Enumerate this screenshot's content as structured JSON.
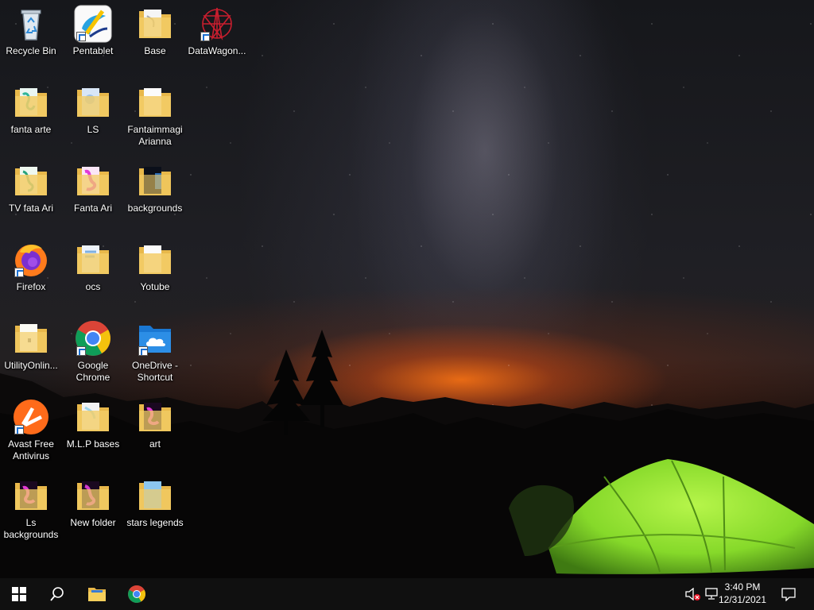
{
  "desktop": {
    "icons": [
      {
        "label": "Recycle Bin",
        "type": "recycle-bin",
        "shortcut": false
      },
      {
        "label": "Pentablet",
        "type": "pentablet-app",
        "shortcut": true
      },
      {
        "label": "Base",
        "type": "folder",
        "shortcut": false
      },
      {
        "label": "DataWagon...",
        "type": "datawagon-app",
        "shortcut": true
      },
      {
        "label": "fanta arte",
        "type": "folder",
        "shortcut": false
      },
      {
        "label": "LS",
        "type": "folder",
        "shortcut": false
      },
      {
        "label": "Fantaimmagi Arianna",
        "type": "folder",
        "shortcut": false
      },
      {
        "label": "TV  fata Ari",
        "type": "folder",
        "shortcut": false
      },
      {
        "label": "Fanta Ari",
        "type": "folder",
        "shortcut": false
      },
      {
        "label": "backgrounds",
        "type": "folder",
        "shortcut": false
      },
      {
        "label": "Firefox",
        "type": "firefox-app",
        "shortcut": true
      },
      {
        "label": "ocs",
        "type": "folder",
        "shortcut": false
      },
      {
        "label": "Yotube",
        "type": "folder",
        "shortcut": false
      },
      {
        "label": "UtilityOnlin...",
        "type": "folder",
        "shortcut": false
      },
      {
        "label": "Google Chrome",
        "type": "chrome-app",
        "shortcut": true
      },
      {
        "label": "OneDrive - Shortcut",
        "type": "onedrive-folder",
        "shortcut": true
      },
      {
        "label": "Avast Free Antivirus",
        "type": "avast-app",
        "shortcut": true
      },
      {
        "label": "M.L.P bases",
        "type": "folder",
        "shortcut": false
      },
      {
        "label": "art",
        "type": "folder",
        "shortcut": false
      },
      {
        "label": "Ls backgrounds",
        "type": "folder",
        "shortcut": false
      },
      {
        "label": "New folder",
        "type": "folder",
        "shortcut": false
      },
      {
        "label": "stars legends",
        "type": "folder",
        "shortcut": false
      }
    ]
  },
  "taskbar": {
    "start": "windows-logo-icon",
    "search": "search-icon",
    "pinned": [
      "file-explorer-icon",
      "chrome-icon"
    ],
    "tray": {
      "volume": "volume-muted-icon",
      "network": "network-icon",
      "notifications": "action-center-icon"
    },
    "clock": {
      "time": "3:40 PM",
      "date": "12/31/2021"
    }
  },
  "colors": {
    "taskbar": "#101010",
    "folder": "#f0c75a",
    "tent": "#8fe42a",
    "horizon_glow": "#f06e14"
  }
}
